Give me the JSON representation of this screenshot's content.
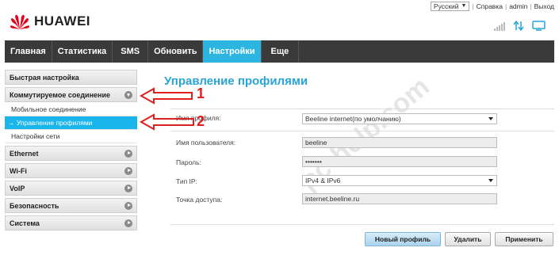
{
  "brand": {
    "name": "HUAWEI"
  },
  "toplinks": {
    "language": "Русский",
    "help": "Справка",
    "user": "admin",
    "logout": "Выход"
  },
  "nav": [
    {
      "label": "Главная"
    },
    {
      "label": "Статистика"
    },
    {
      "label": "SMS"
    },
    {
      "label": "Обновить"
    },
    {
      "label": "Настройки",
      "active": true
    },
    {
      "label": "Еще"
    }
  ],
  "sidebar": {
    "quick_setup": "Быстрая настройка",
    "dialup": "Коммутируемое соединение",
    "dialup_items": [
      "Мобильное соединение",
      "→ Управление профилями",
      "Настройки сети"
    ],
    "groups": [
      "Ethernet",
      "Wi-Fi",
      "VoIP",
      "Безопасность",
      "Система"
    ]
  },
  "main": {
    "title": "Управление профилями",
    "profile_label": "Имя профиля:",
    "profile_value": "Beeline internet(по умолчанию)",
    "username_label": "Имя пользователя:",
    "username_value": "beeline",
    "password_label": "Пароль:",
    "password_value": "•••••••",
    "iptype_label": "Тип IP:",
    "iptype_value": "IPv4 & IPv6",
    "apn_label": "Точка доступа:",
    "apn_value": "internet.beeline.ru"
  },
  "buttons": {
    "new_profile": "Новый профиль",
    "delete": "Удалить",
    "apply": "Применить"
  },
  "annotations": {
    "one": "1",
    "two": "2"
  },
  "colors": {
    "accent": "#2bb5e0",
    "nav_bg": "#3a3a3a",
    "annotation": "#e02020"
  },
  "watermark": "pc-help.com"
}
